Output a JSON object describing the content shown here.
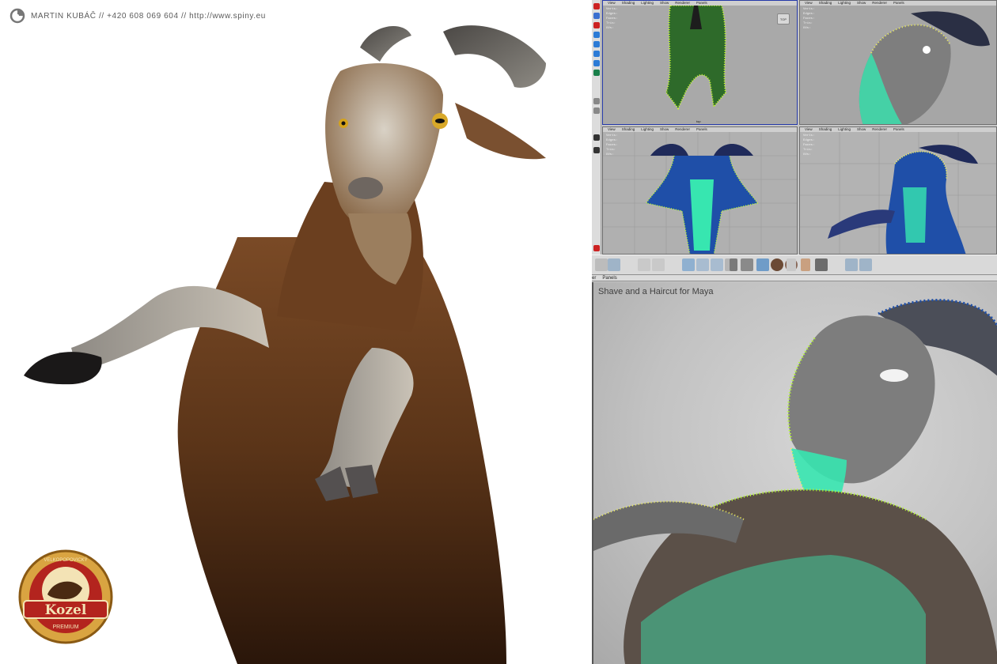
{
  "header": {
    "credit": "MARTIN KUBÁČ // +420 608 069 604  //  http://www.spiny.eu"
  },
  "badge": {
    "arc_text": "VELKOPOPOVICKÝ",
    "brand": "Kozel",
    "ribbon": "PREMIUM",
    "colors": {
      "gold": "#d9a441",
      "red": "#b3241e",
      "cream": "#f3e3b5"
    }
  },
  "maya": {
    "viewport_menu": [
      "View",
      "Shading",
      "Lighting",
      "Show",
      "Renderer",
      "Panels"
    ],
    "hud_keys": [
      "Verts:",
      "Edges:",
      "Faces:",
      "Tris:",
      "UVs:"
    ],
    "viewports": [
      {
        "id": "top",
        "label": "top",
        "cube": "TOP"
      },
      {
        "id": "persp",
        "label": "",
        "cube": ""
      },
      {
        "id": "front",
        "label": "",
        "cube": ""
      },
      {
        "id": "side",
        "label": "",
        "cube": ""
      }
    ],
    "render_menu": [
      "er",
      "Panels"
    ],
    "render_title": "Shave and a Haircut for Maya",
    "accent_color": "#2438a8",
    "hair_colors": [
      "#b8ff2a",
      "#37e6b0",
      "#1f4fa8",
      "#f3f35a"
    ]
  }
}
